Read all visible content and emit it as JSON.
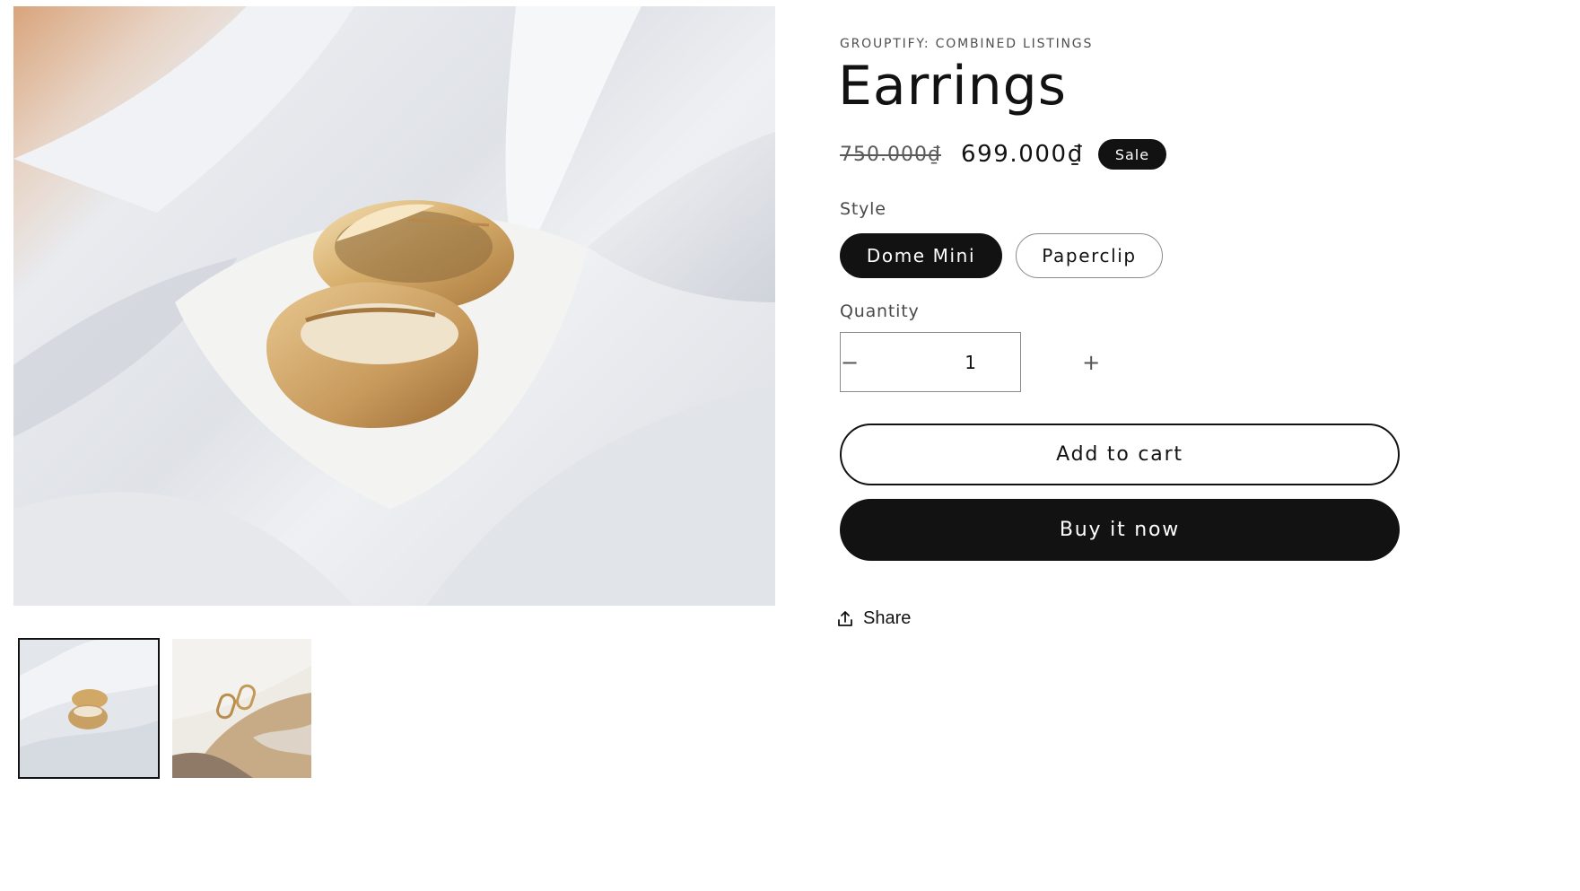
{
  "product": {
    "vendor": "GROUPTIFY: COMBINED LISTINGS",
    "title": "Earrings",
    "price_compare": "750.000₫",
    "price_sale": "699.000₫",
    "badge": "Sale"
  },
  "options": {
    "style_label": "Style",
    "styles": [
      "Dome Mini",
      "Paperclip"
    ],
    "selected_style": "Dome Mini"
  },
  "quantity": {
    "label": "Quantity",
    "value": "1",
    "decrease_symbol": "−",
    "increase_symbol": "+"
  },
  "actions": {
    "add_to_cart": "Add to cart",
    "buy_now": "Buy it now",
    "share": "Share"
  },
  "icons": {
    "share": "share-icon"
  },
  "gallery": {
    "thumbnails": [
      "dome-mini-hoops-on-white-fabric",
      "paperclip-hoops-on-stone"
    ],
    "selected_thumbnail": 0
  },
  "colors": {
    "primary": "#121212",
    "background": "#ffffff",
    "gold": "#c9a46a"
  }
}
